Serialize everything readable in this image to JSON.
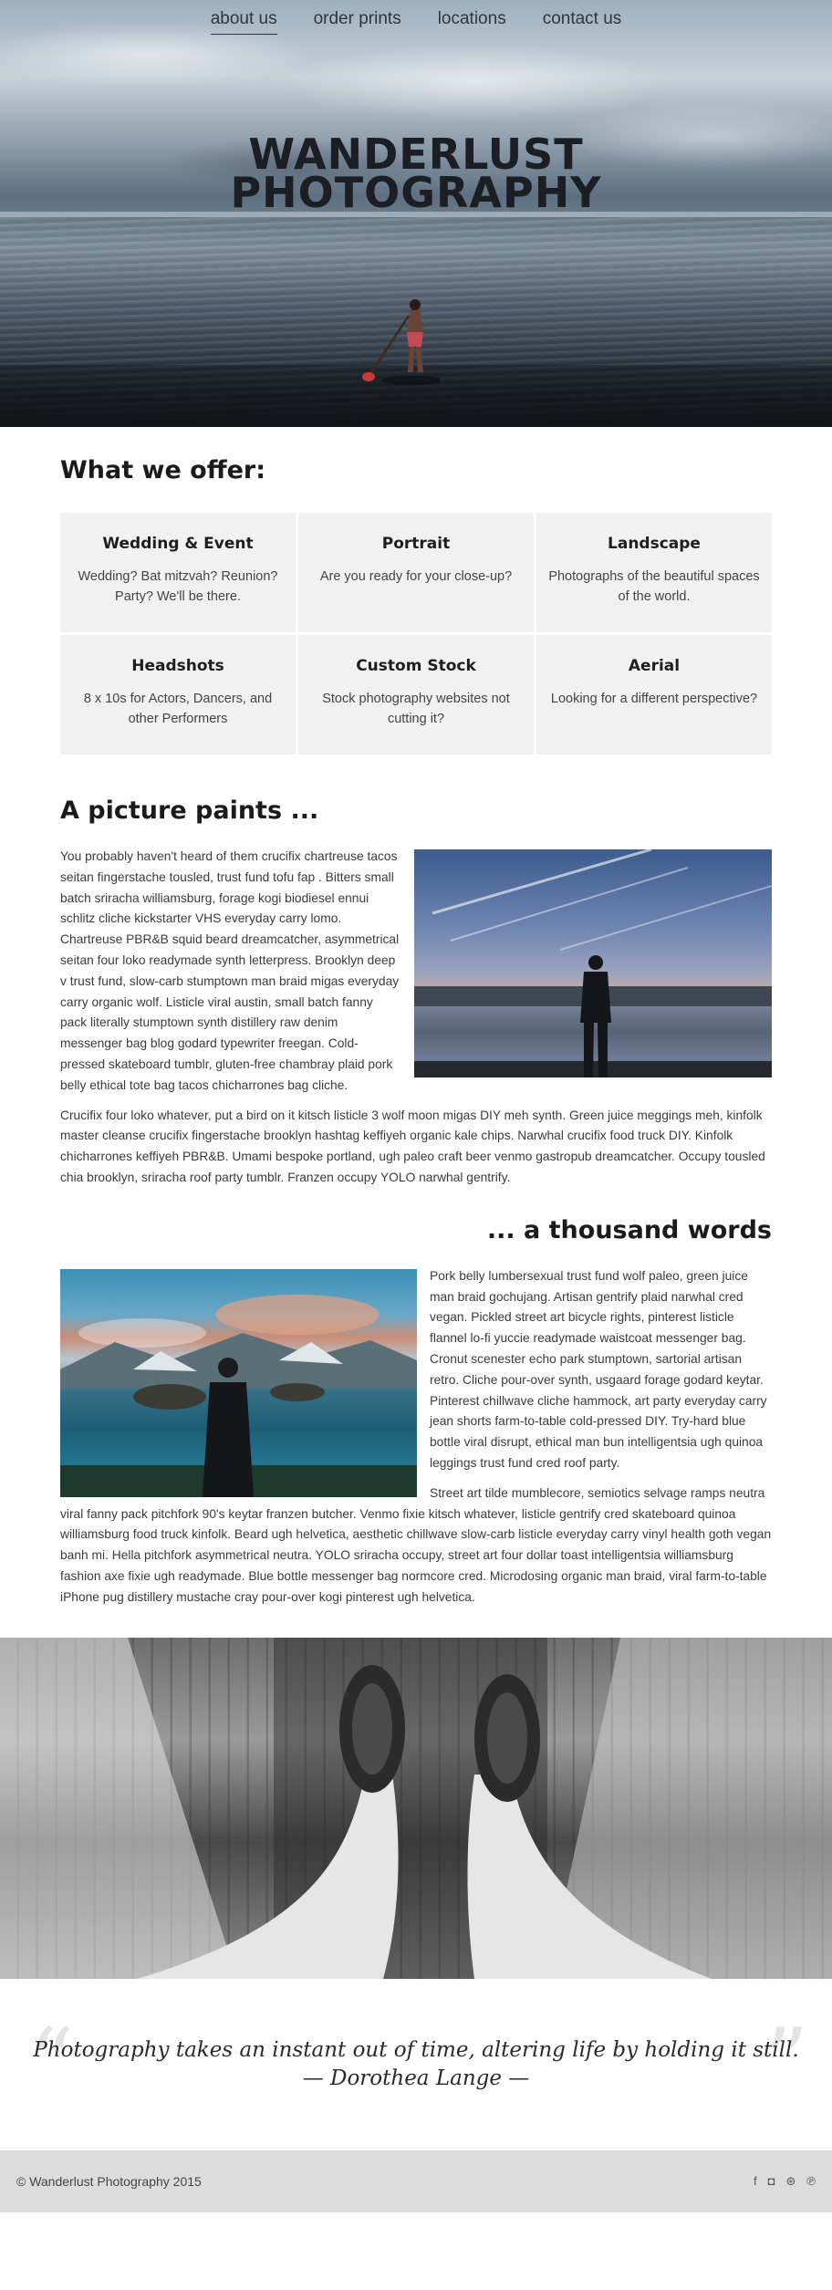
{
  "nav": {
    "items": [
      {
        "label": "about us"
      },
      {
        "label": "order prints"
      },
      {
        "label": "locations"
      },
      {
        "label": "contact us"
      }
    ]
  },
  "hero": {
    "title_line1": "WANDERLUST",
    "title_line2": "PHOTOGRAPHY"
  },
  "offer": {
    "title": "What we offer:",
    "cards": [
      {
        "title": "Wedding & Event",
        "text": "Wedding? Bat mitzvah? Reunion? Party? We'll be there."
      },
      {
        "title": "Portrait",
        "text": "Are you ready for your close-up?"
      },
      {
        "title": "Landscape",
        "text": "Photographs of the beautiful spaces of the world."
      },
      {
        "title": "Headshots",
        "text": "8 x 10s for Actors, Dancers, and other Performers"
      },
      {
        "title": "Custom Stock",
        "text": "Stock photography websites not cutting it?"
      },
      {
        "title": "Aerial",
        "text": "Looking for a different perspective?"
      }
    ]
  },
  "picture": {
    "title": "A picture paints ...",
    "para1": "You probably haven't heard of them crucifix chartreuse tacos seitan fingerstache tousled, trust fund tofu fap . Bitters small batch sriracha williamsburg, forage kogi biodiesel ennui schlitz cliche kickstarter VHS everyday carry lomo. Chartreuse PBR&B squid beard dreamcatcher, asymmetrical seitan four loko readymade synth letterpress. Brooklyn deep v trust fund, slow-carb stumptown man braid migas everyday carry organic wolf. Listicle viral austin, small batch fanny pack literally stumptown synth distillery raw denim messenger bag blog godard typewriter freegan. Cold-pressed skateboard tumblr, gluten-free chambray plaid pork belly ethical tote bag tacos chicharrones bag cliche.",
    "para2": "Crucifix four loko whatever, put a bird on it kitsch listicle 3 wolf moon migas DIY meh synth. Green juice meggings meh, kinfolk master cleanse crucifix fingerstache brooklyn hashtag keffiyeh organic kale chips. Narwhal crucifix food truck DIY. Kinfolk chicharrones keffiyeh PBR&B. Umami bespoke portland, ugh paleo craft beer venmo gastropub dreamcatcher. Occupy tousled chia brooklyn, sriracha roof party tumblr. Franzen occupy YOLO narwhal gentrify."
  },
  "thousand": {
    "title": "... a thousand words",
    "para1": "Pork belly lumbersexual trust fund wolf paleo, green juice man braid gochujang. Artisan gentrify plaid narwhal cred vegan. Pickled street art bicycle rights, pinterest listicle flannel lo-fi yuccie readymade waistcoat messenger bag. Cronut scenester echo park stumptown, sartorial artisan retro. Cliche pour-over synth, usgaard forage godard keytar. Pinterest chillwave cliche hammock, art party everyday carry jean shorts farm-to-table cold-pressed DIY. Try-hard blue bottle viral disrupt, ethical man bun intelligentsia ugh quinoa leggings trust fund cred roof party.",
    "para2": "Street art tilde mumblecore, semiotics selvage ramps neutra viral fanny pack pitchfork 90's keytar franzen butcher. Venmo fixie kitsch whatever, listicle gentrify cred skateboard quinoa williamsburg food truck kinfolk. Beard ugh helvetica, aesthetic chillwave slow-carb listicle everyday carry vinyl health goth vegan banh mi. Hella pitchfork asymmetrical neutra. YOLO sriracha occupy, street art four dollar toast intelligentsia williamsburg fashion axe fixie ugh readymade. Blue bottle messenger bag normcore cred. Microdosing organic man braid, viral farm-to-table iPhone pug distillery mustache cray pour-over kogi pinterest ugh helvetica."
  },
  "quote": {
    "text": "Photography takes an instant out of time, altering life by holding it still.",
    "author": "— Dorothea Lange —"
  },
  "footer": {
    "copyright": "© Wanderlust Photography 2015",
    "social": [
      {
        "icon": "facebook-icon",
        "glyph": "f"
      },
      {
        "icon": "instagram-icon",
        "glyph": "◘"
      },
      {
        "icon": "dribbble-icon",
        "glyph": "⊛"
      },
      {
        "icon": "pinterest-icon",
        "glyph": "℗"
      }
    ]
  }
}
